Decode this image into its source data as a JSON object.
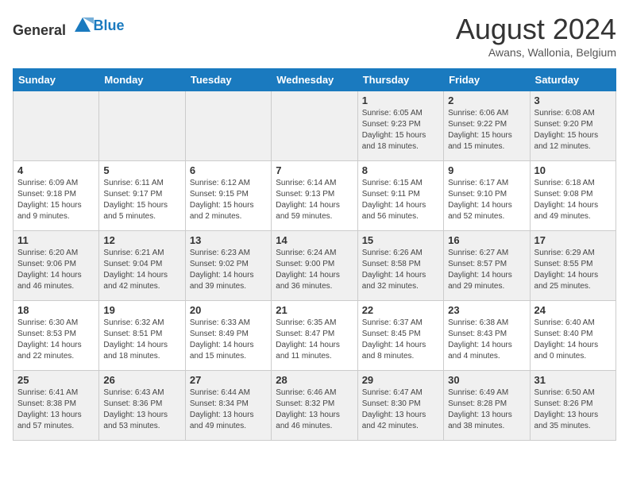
{
  "logo": {
    "general": "General",
    "blue": "Blue"
  },
  "title": "August 2024",
  "location": "Awans, Wallonia, Belgium",
  "days_of_week": [
    "Sunday",
    "Monday",
    "Tuesday",
    "Wednesday",
    "Thursday",
    "Friday",
    "Saturday"
  ],
  "weeks": [
    [
      {
        "day": "",
        "info": ""
      },
      {
        "day": "",
        "info": ""
      },
      {
        "day": "",
        "info": ""
      },
      {
        "day": "",
        "info": ""
      },
      {
        "day": "1",
        "info": "Sunrise: 6:05 AM\nSunset: 9:23 PM\nDaylight: 15 hours\nand 18 minutes."
      },
      {
        "day": "2",
        "info": "Sunrise: 6:06 AM\nSunset: 9:22 PM\nDaylight: 15 hours\nand 15 minutes."
      },
      {
        "day": "3",
        "info": "Sunrise: 6:08 AM\nSunset: 9:20 PM\nDaylight: 15 hours\nand 12 minutes."
      }
    ],
    [
      {
        "day": "4",
        "info": "Sunrise: 6:09 AM\nSunset: 9:18 PM\nDaylight: 15 hours\nand 9 minutes."
      },
      {
        "day": "5",
        "info": "Sunrise: 6:11 AM\nSunset: 9:17 PM\nDaylight: 15 hours\nand 5 minutes."
      },
      {
        "day": "6",
        "info": "Sunrise: 6:12 AM\nSunset: 9:15 PM\nDaylight: 15 hours\nand 2 minutes."
      },
      {
        "day": "7",
        "info": "Sunrise: 6:14 AM\nSunset: 9:13 PM\nDaylight: 14 hours\nand 59 minutes."
      },
      {
        "day": "8",
        "info": "Sunrise: 6:15 AM\nSunset: 9:11 PM\nDaylight: 14 hours\nand 56 minutes."
      },
      {
        "day": "9",
        "info": "Sunrise: 6:17 AM\nSunset: 9:10 PM\nDaylight: 14 hours\nand 52 minutes."
      },
      {
        "day": "10",
        "info": "Sunrise: 6:18 AM\nSunset: 9:08 PM\nDaylight: 14 hours\nand 49 minutes."
      }
    ],
    [
      {
        "day": "11",
        "info": "Sunrise: 6:20 AM\nSunset: 9:06 PM\nDaylight: 14 hours\nand 46 minutes."
      },
      {
        "day": "12",
        "info": "Sunrise: 6:21 AM\nSunset: 9:04 PM\nDaylight: 14 hours\nand 42 minutes."
      },
      {
        "day": "13",
        "info": "Sunrise: 6:23 AM\nSunset: 9:02 PM\nDaylight: 14 hours\nand 39 minutes."
      },
      {
        "day": "14",
        "info": "Sunrise: 6:24 AM\nSunset: 9:00 PM\nDaylight: 14 hours\nand 36 minutes."
      },
      {
        "day": "15",
        "info": "Sunrise: 6:26 AM\nSunset: 8:58 PM\nDaylight: 14 hours\nand 32 minutes."
      },
      {
        "day": "16",
        "info": "Sunrise: 6:27 AM\nSunset: 8:57 PM\nDaylight: 14 hours\nand 29 minutes."
      },
      {
        "day": "17",
        "info": "Sunrise: 6:29 AM\nSunset: 8:55 PM\nDaylight: 14 hours\nand 25 minutes."
      }
    ],
    [
      {
        "day": "18",
        "info": "Sunrise: 6:30 AM\nSunset: 8:53 PM\nDaylight: 14 hours\nand 22 minutes."
      },
      {
        "day": "19",
        "info": "Sunrise: 6:32 AM\nSunset: 8:51 PM\nDaylight: 14 hours\nand 18 minutes."
      },
      {
        "day": "20",
        "info": "Sunrise: 6:33 AM\nSunset: 8:49 PM\nDaylight: 14 hours\nand 15 minutes."
      },
      {
        "day": "21",
        "info": "Sunrise: 6:35 AM\nSunset: 8:47 PM\nDaylight: 14 hours\nand 11 minutes."
      },
      {
        "day": "22",
        "info": "Sunrise: 6:37 AM\nSunset: 8:45 PM\nDaylight: 14 hours\nand 8 minutes."
      },
      {
        "day": "23",
        "info": "Sunrise: 6:38 AM\nSunset: 8:43 PM\nDaylight: 14 hours\nand 4 minutes."
      },
      {
        "day": "24",
        "info": "Sunrise: 6:40 AM\nSunset: 8:40 PM\nDaylight: 14 hours\nand 0 minutes."
      }
    ],
    [
      {
        "day": "25",
        "info": "Sunrise: 6:41 AM\nSunset: 8:38 PM\nDaylight: 13 hours\nand 57 minutes."
      },
      {
        "day": "26",
        "info": "Sunrise: 6:43 AM\nSunset: 8:36 PM\nDaylight: 13 hours\nand 53 minutes."
      },
      {
        "day": "27",
        "info": "Sunrise: 6:44 AM\nSunset: 8:34 PM\nDaylight: 13 hours\nand 49 minutes."
      },
      {
        "day": "28",
        "info": "Sunrise: 6:46 AM\nSunset: 8:32 PM\nDaylight: 13 hours\nand 46 minutes."
      },
      {
        "day": "29",
        "info": "Sunrise: 6:47 AM\nSunset: 8:30 PM\nDaylight: 13 hours\nand 42 minutes."
      },
      {
        "day": "30",
        "info": "Sunrise: 6:49 AM\nSunset: 8:28 PM\nDaylight: 13 hours\nand 38 minutes."
      },
      {
        "day": "31",
        "info": "Sunrise: 6:50 AM\nSunset: 8:26 PM\nDaylight: 13 hours\nand 35 minutes."
      }
    ]
  ]
}
